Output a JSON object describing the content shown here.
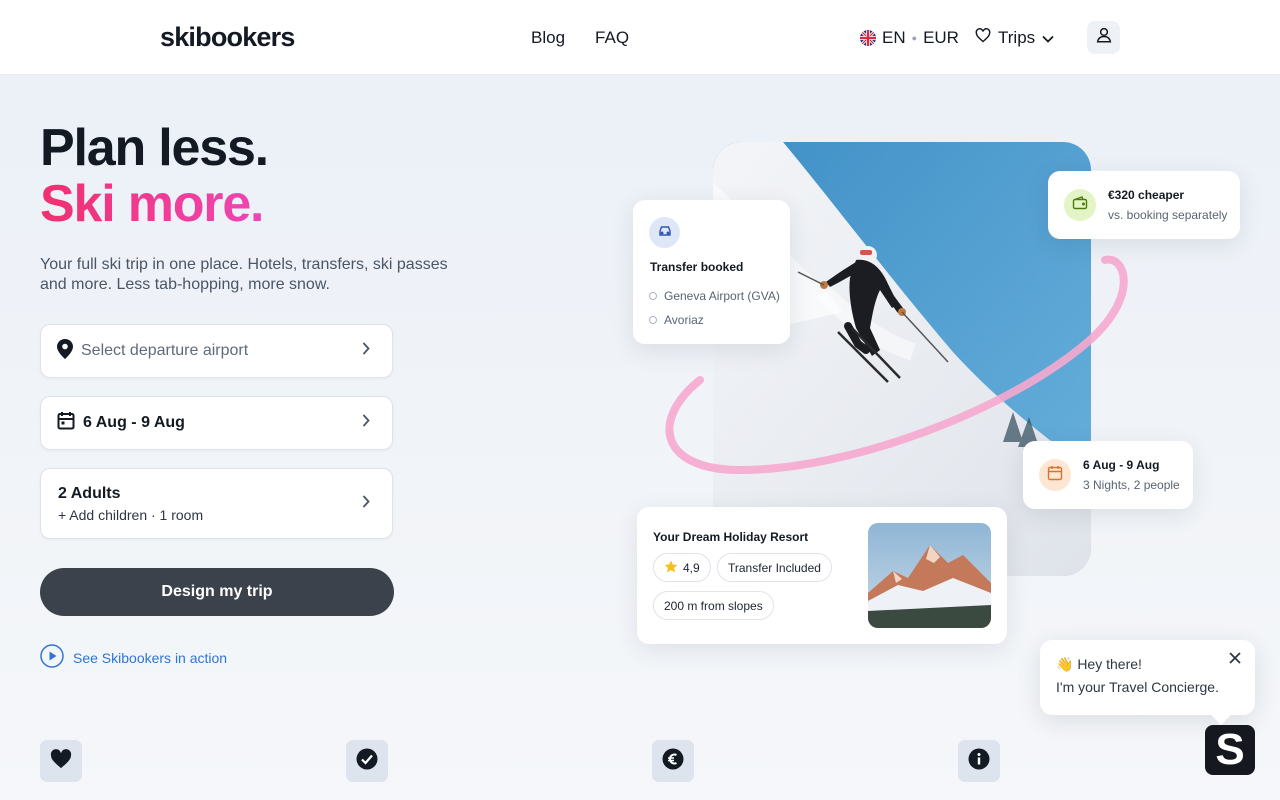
{
  "header": {
    "logo": "skibookers",
    "nav": [
      "Blog",
      "FAQ"
    ],
    "language": "EN",
    "currency": "EUR",
    "trips_label": "Trips"
  },
  "hero": {
    "title_line1": "Plan less.",
    "title_line2": "Ski more.",
    "subtitle": "Your full ski trip in one place. Hotels, transfers, ski passes and more. Less tab-hopping, more snow."
  },
  "form": {
    "departure_placeholder": "Select departure airport",
    "dates": "6 Aug - 9 Aug",
    "guests_main": "2 Adults",
    "guests_sub": "+ Add children · 1 room",
    "cta_label": "Design my trip",
    "video_link": "See Skibookers in action"
  },
  "cards": {
    "transfer": {
      "title": "Transfer booked",
      "from": "Geneva Airport (GVA)",
      "to": "Avoriaz"
    },
    "savings": {
      "title": "€320 cheaper",
      "subtitle": "vs. booking separately"
    },
    "dates": {
      "title": "6 Aug - 9 Aug",
      "subtitle": "3 Nights, 2 people"
    },
    "resort": {
      "title": "Your Dream Holiday Resort",
      "rating": "4,9",
      "tag1": "Transfer Included",
      "tag2": "200 m from slopes"
    }
  },
  "chat": {
    "greeting": "👋 Hey there!",
    "message": "I'm your Travel Concierge.",
    "launcher_letter": "S"
  },
  "icons": [
    "location-pin-icon",
    "calendar-icon",
    "chevron-right-icon",
    "play-icon",
    "heart-icon",
    "check-icon",
    "euro-icon",
    "info-icon",
    "car-icon",
    "wallet-icon",
    "star-icon",
    "user-icon",
    "close-icon"
  ],
  "colors": {
    "accent_pink": "#f0306f",
    "accent_magenta": "#ef47b8",
    "cta_bg": "#3c424b",
    "link_blue": "#2f74d6"
  }
}
